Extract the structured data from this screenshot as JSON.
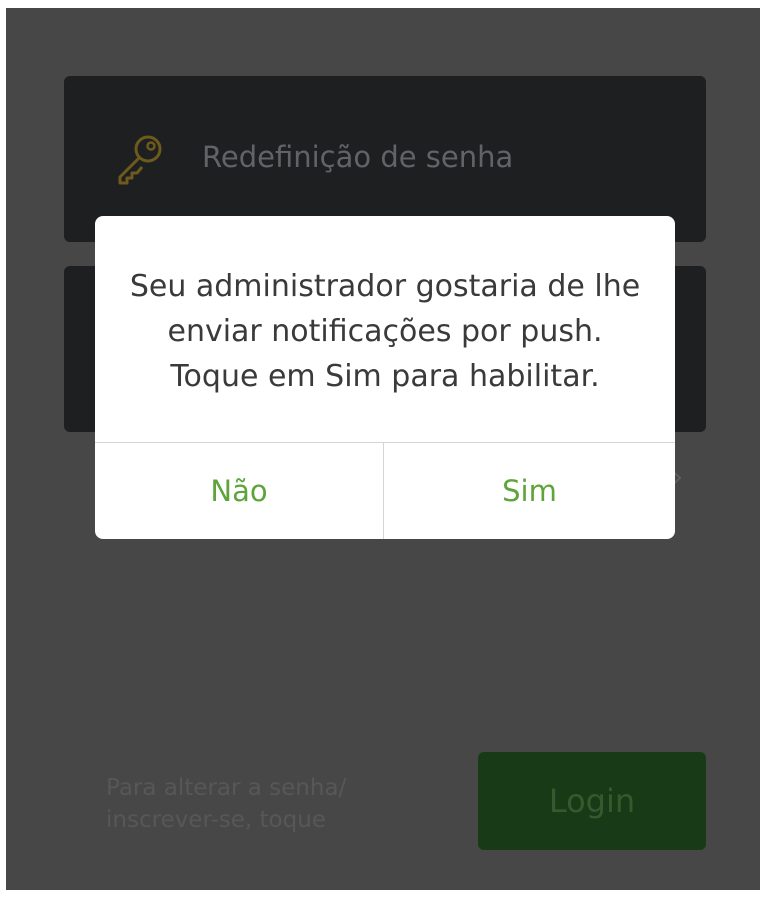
{
  "background": {
    "reset_card": {
      "label": "Redefinição de senha",
      "icon": "key-icon"
    },
    "chevron": "›",
    "hint": "Para alterar a senha/ inscrever-se, toque",
    "login_label": "Login"
  },
  "dialog": {
    "message_lines": [
      "Seu administrador gostaria de lhe",
      "enviar notificações por push.",
      "Toque em Sim para habilitar."
    ],
    "no_label": "Não",
    "yes_label": "Sim"
  },
  "colors": {
    "overlay_background": "#474747",
    "card": "#1d1f20",
    "accent_green": "#5ea43a",
    "login_button": "#183a17",
    "key_icon": "#6e5a1c"
  }
}
